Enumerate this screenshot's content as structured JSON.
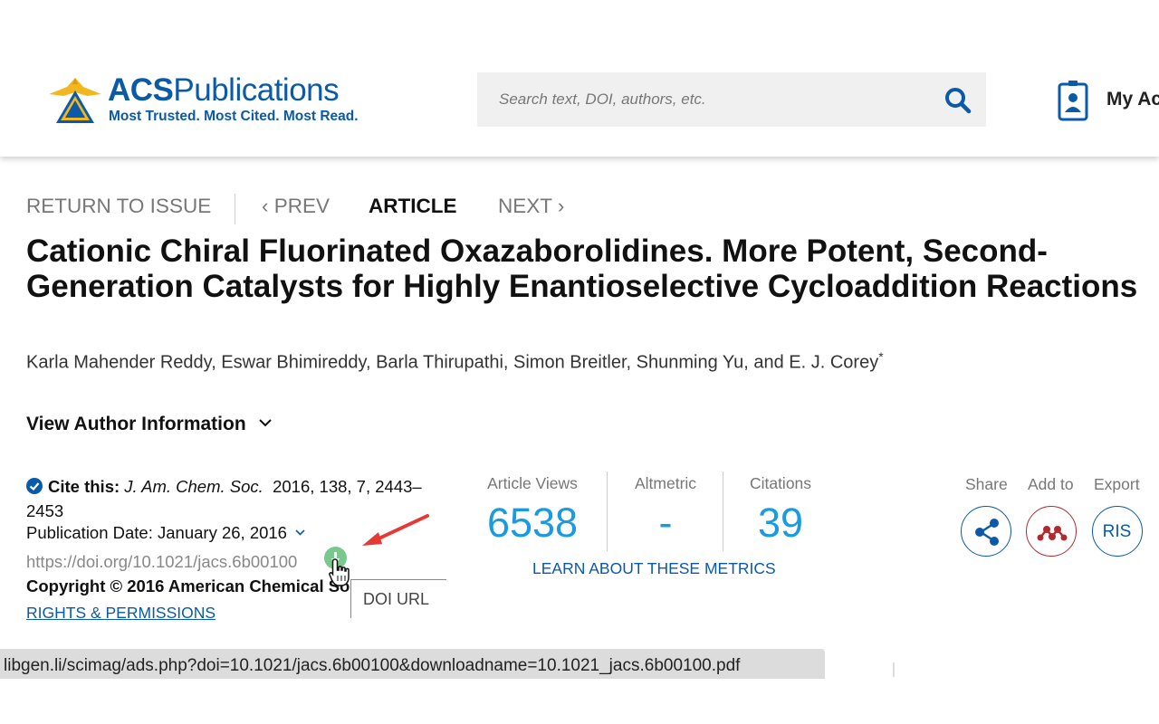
{
  "header": {
    "logo_name_bold": "ACS",
    "logo_name_rest": "Publications",
    "logo_tagline": "Most Trusted. Most Cited. Most Read.",
    "search_placeholder": "Search text, DOI, authors, etc.",
    "account_label": "My Ac"
  },
  "nav": {
    "return_label": "RETURN TO ISSUE",
    "prev_label": "‹ PREV",
    "article_label": "ARTICLE",
    "next_label": "NEXT ›"
  },
  "article": {
    "title": "Cationic Chiral Fluorinated Oxazaborolidines. More Potent, Second-Generation Catalysts for Highly Enantioselective Cycloaddition Reactions",
    "authors": "Karla Mahender Reddy, Eswar Bhimireddy, Barla Thirupathi, Simon Breitler, Shunming Yu, and E. J. Corey",
    "authors_marker": "*",
    "view_author_info": "View Author Information"
  },
  "cite": {
    "label": "Cite this:",
    "journal": "J. Am. Chem. Soc.",
    "details": "2016, 138, 7, 2443–2453",
    "publication_date": "Publication Date: January 26, 2016",
    "doi": "https://doi.org/10.1021/jacs.6b00100",
    "copyright": "Copyright © 2016 American Chemical Society",
    "rights": "RIGHTS & PERMISSIONS"
  },
  "tooltip": {
    "text": "DOI URL"
  },
  "metrics": {
    "views_label": "Article Views",
    "views_value": "6538",
    "altmetric_label": "Altmetric",
    "altmetric_value": "-",
    "citations_label": "Citations",
    "citations_value": "39",
    "learn_link": "LEARN ABOUT THESE METRICS"
  },
  "actions": {
    "share_label": "Share",
    "add_label": "Add to",
    "export_label": "Export",
    "export_button": "RIS",
    "share_icon": "share-icon",
    "add_icon": "mendeley-icon"
  },
  "status_bar": {
    "url": "libgen.li/scimag/ads.php?doi=10.1021/jacs.6b00100&downloadname=10.1021_jacs.6b00100.pdf"
  },
  "colors": {
    "brand_blue": "#0b5aa8",
    "metric_blue": "#1a9be0",
    "mendeley_red": "#b22a30",
    "download_green": "#79c98e",
    "arrow_red": "#e53935"
  }
}
